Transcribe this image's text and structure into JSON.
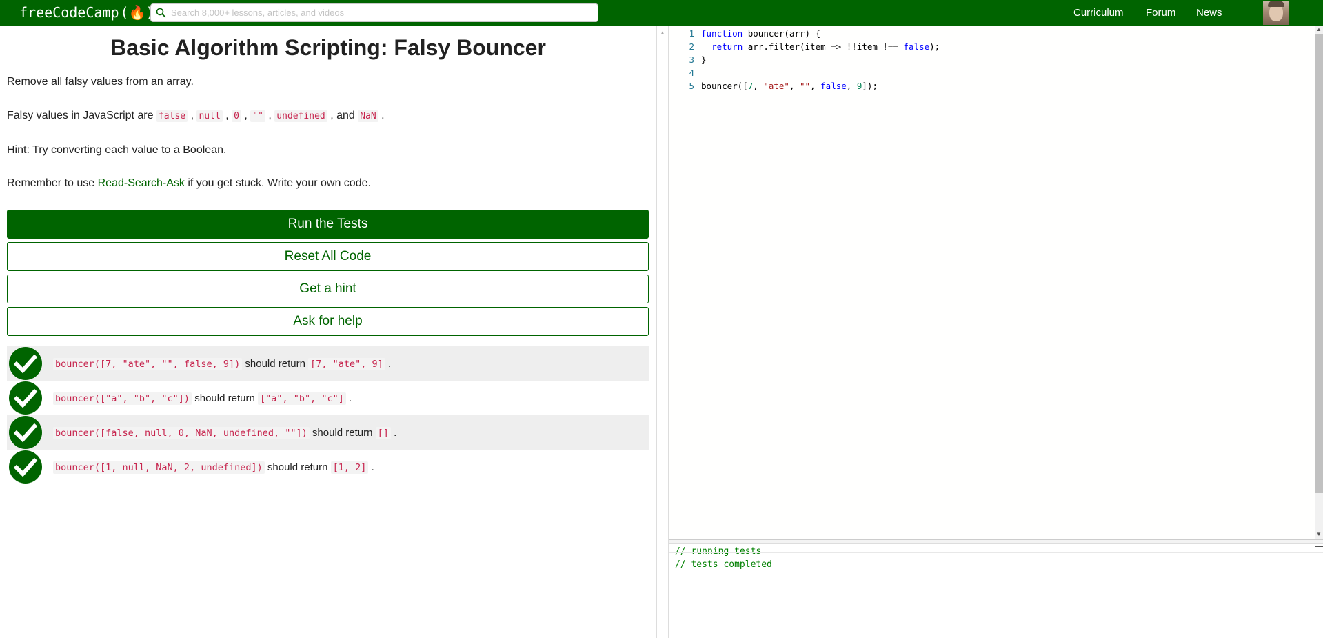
{
  "navbar": {
    "brand": "freeCodeCamp",
    "brand_glyph": "(🔥)",
    "search_placeholder": "Search 8,000+ lessons, articles, and videos",
    "links": [
      "Curriculum",
      "Forum",
      "News"
    ],
    "bg_color": "#006400"
  },
  "challenge": {
    "title": "Basic Algorithm Scripting: Falsy Bouncer",
    "intro": "Remove all falsy values from an array.",
    "falsy_prefix": "Falsy values in JavaScript are ",
    "falsy_values": [
      "false",
      "null",
      "0",
      "\"\"",
      "undefined",
      "NaN"
    ],
    "falsy_and": ", and ",
    "falsy_sep": " , ",
    "falsy_end": " .",
    "hint": "Hint: Try converting each value to a Boolean.",
    "remember_prefix": "Remember to use ",
    "remember_link": "Read-Search-Ask",
    "remember_suffix": " if you get stuck. Write your own code."
  },
  "buttons": {
    "run": "Run the Tests",
    "reset": "Reset All Code",
    "hint": "Get a hint",
    "help": "Ask for help"
  },
  "tests": [
    {
      "call": "bouncer([7, \"ate\", \"\", false, 9])",
      "middle": " should return ",
      "expected": "[7, \"ate\", 9]",
      "end": " .",
      "passed": true
    },
    {
      "call": "bouncer([\"a\", \"b\", \"c\"])",
      "middle": " should return ",
      "expected": "[\"a\", \"b\", \"c\"]",
      "end": " .",
      "passed": true
    },
    {
      "call": "bouncer([false, null, 0, NaN, undefined, \"\"])",
      "middle": " should return ",
      "expected": "[]",
      "end": " .",
      "passed": true
    },
    {
      "call": "bouncer([1, null, NaN, 2, undefined])",
      "middle": " should return ",
      "expected": "[1, 2]",
      "end": " .",
      "passed": true
    }
  ],
  "editor": {
    "line_numbers": [
      "1",
      "2",
      "3",
      "4",
      "5"
    ],
    "line1": {
      "kw": "function",
      "rest": " bouncer(arr) {"
    },
    "line2": {
      "indent": "  ",
      "kw": "return",
      "mid": " arr.filter(item => !!item !== ",
      "kw2": "false",
      "end": ");"
    },
    "line3": {
      "text": "}"
    },
    "line5": {
      "a": "bouncer([",
      "n1": "7",
      "c1": ", ",
      "s1": "\"ate\"",
      "c2": ", ",
      "s2": "\"\"",
      "c3": ", ",
      "k1": "false",
      "c4": ", ",
      "n2": "9",
      "end": "]);"
    }
  },
  "console": {
    "lines": [
      "// running tests",
      "// tests completed"
    ]
  },
  "colors": {
    "accent": "#006400",
    "code_text": "#c7254e",
    "console_text": "#008000"
  },
  "icons": {
    "search": "search-icon",
    "check": "check-circle-icon",
    "avatar": "user-avatar"
  }
}
